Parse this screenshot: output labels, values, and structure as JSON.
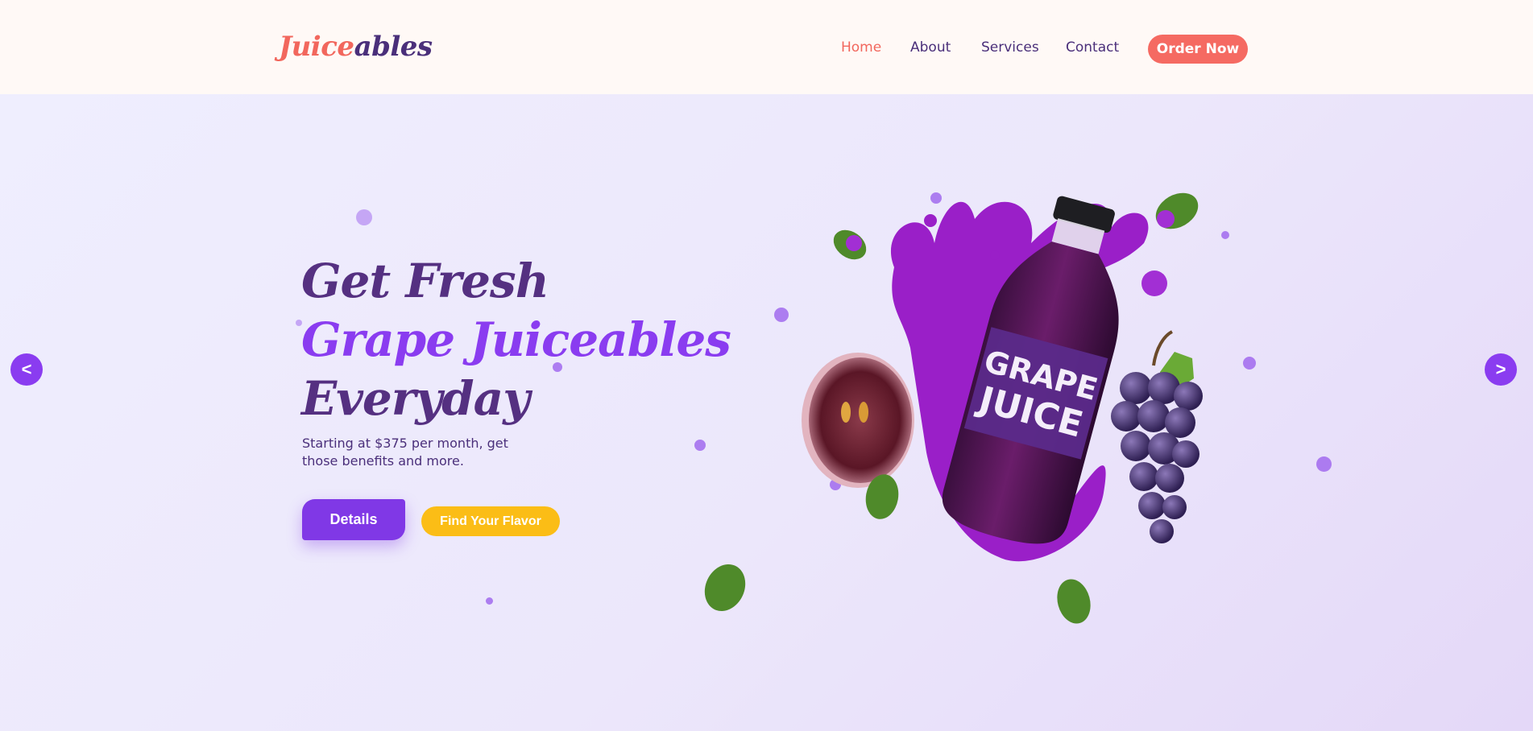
{
  "header": {
    "logo": {
      "part1": "Juice",
      "part2": "ables"
    },
    "nav": [
      {
        "label": "Home",
        "active": true
      },
      {
        "label": "About",
        "active": false
      },
      {
        "label": "Services",
        "active": false
      },
      {
        "label": "Contact",
        "active": false
      }
    ],
    "cta_label": "Order Now"
  },
  "hero": {
    "headline_line1": "Get Fresh",
    "headline_line2": "Grape Juiceables",
    "headline_line3": "Everyday",
    "subtext": "Starting at $375 per month, get those benefits and more.",
    "primary_button": "Details",
    "secondary_button": "Find Your Flavor",
    "bottle_label_line1": "GRAPE",
    "bottle_label_line2": "JUICE"
  },
  "carousel": {
    "prev_label": "<",
    "next_label": ">"
  },
  "colors": {
    "accent_coral": "#f2675d",
    "brand_purple_dark": "#4a2f7a",
    "brand_purple": "#8a3cf0",
    "yellow": "#fbbd16",
    "header_bg": "#fff9f6"
  },
  "icons": [
    "chevron-left-icon",
    "chevron-right-icon",
    "grape-juice-illustration"
  ]
}
